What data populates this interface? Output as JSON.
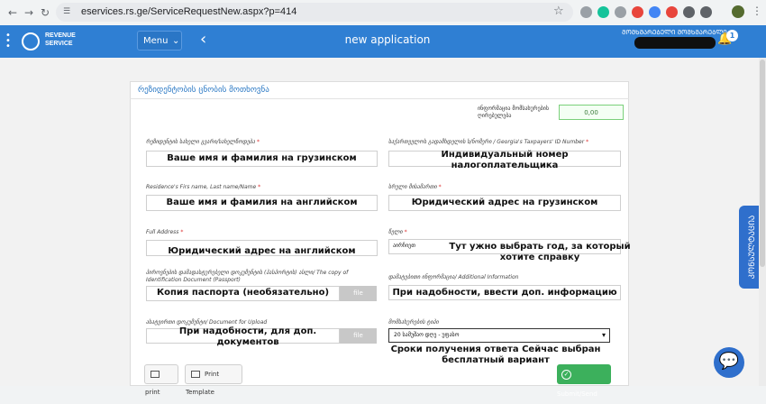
{
  "browser": {
    "url": "eservices.rs.ge/ServiceRequestNew.aspx?p=414",
    "extensions": [
      {
        "icon": "shield-ext-icon",
        "color": "#9aa0a6"
      },
      {
        "icon": "grammarly-ext-icon",
        "color": "#15c39a"
      },
      {
        "icon": "edit-ext-icon",
        "color": "#9aa0a6"
      },
      {
        "icon": "adblock-ext-icon",
        "color": "#e8453c"
      },
      {
        "icon": "wallet-ext-icon",
        "color": "#4285f4"
      },
      {
        "icon": "opera-ext-icon",
        "color": "#e8453c"
      },
      {
        "icon": "extensions-puzzle-icon",
        "color": "#5f6368"
      },
      {
        "icon": "bookmark-ext-icon",
        "color": "#5f6368"
      }
    ]
  },
  "header": {
    "logo_line1": "REVENUE",
    "logo_line2": "SERVICE",
    "menu_label": "Menu",
    "title": "new application",
    "user_label": "ᲛᲝᲛᲮᲛᲐᲠᲔᲑᲔᲚᲘ ᲛᲝᲛᲮᲛᲐᲠᲔᲑᲚᲘ",
    "notification_count": "1"
  },
  "form": {
    "title": "რეზიდენტობის ცნობის მოთხოვნა",
    "fee_label": "ინფორმაცია მომსახურების ღირებულება",
    "fee_value": "0,00",
    "fields": {
      "name_geo_label": "რეზიდენტის სახელი გვარი/სახელწოდება",
      "name_geo_value": "Ваше имя и фамилия на грузинском",
      "tax_id_label": "საქართველოს გადამხდელის ს/ნომერი / Georgia's Taxpayers' ID Number",
      "tax_id_value": "Индивидуальный номер налогоплательщика",
      "name_en_label": "Residence's Firs name, Last name/Name",
      "name_en_value": "Ваше имя и фамилия на английском",
      "address_geo_label": "სრული მისამართი",
      "address_geo_value": "Юридический адрес на грузинском",
      "address_en_label": "Full Address",
      "address_en_value": "Юридический адрес на английском",
      "year_label": "წელი",
      "year_select_text": "აირჩიეთ",
      "year_value": "Тут ужно выбрать год, за который хотите справку",
      "passport_label": "პიროვნების დამადასტურებელი დოკუმენტის (პასპორტის) ასლი/ The copy of Identification Document (Passport)",
      "passport_value": "Копия паспорта (необязательно)",
      "passport_file_btn": "file",
      "additional_label": "დამატებითი ინფორმაცია/ Additional Information",
      "additional_value": "При надобности, ввести доп. информацию",
      "upload_label": "ასატვირთი დოკუმენტი/ Document for Upload",
      "upload_value": "При надобности, для доп. документов",
      "upload_file_btn": "file",
      "service_type_label": "მომსახურების ტიპი",
      "service_type_selected": "20 სამუშაო დღე - უფასო",
      "service_type_note": "Сроки получения ответа Сейчас выбран бесплатный вариант"
    },
    "buttons": {
      "print": "print",
      "print_template": "Print Template",
      "submit": "Submit/Send"
    }
  },
  "side_tab_label": "ᲙᲝᲜᲡᲣᲚᲢᲐᲪᲘᲐ",
  "colors": {
    "brand_blue": "#2f7fd3",
    "submit_green": "#3cb05c",
    "required_red": "#d33"
  }
}
